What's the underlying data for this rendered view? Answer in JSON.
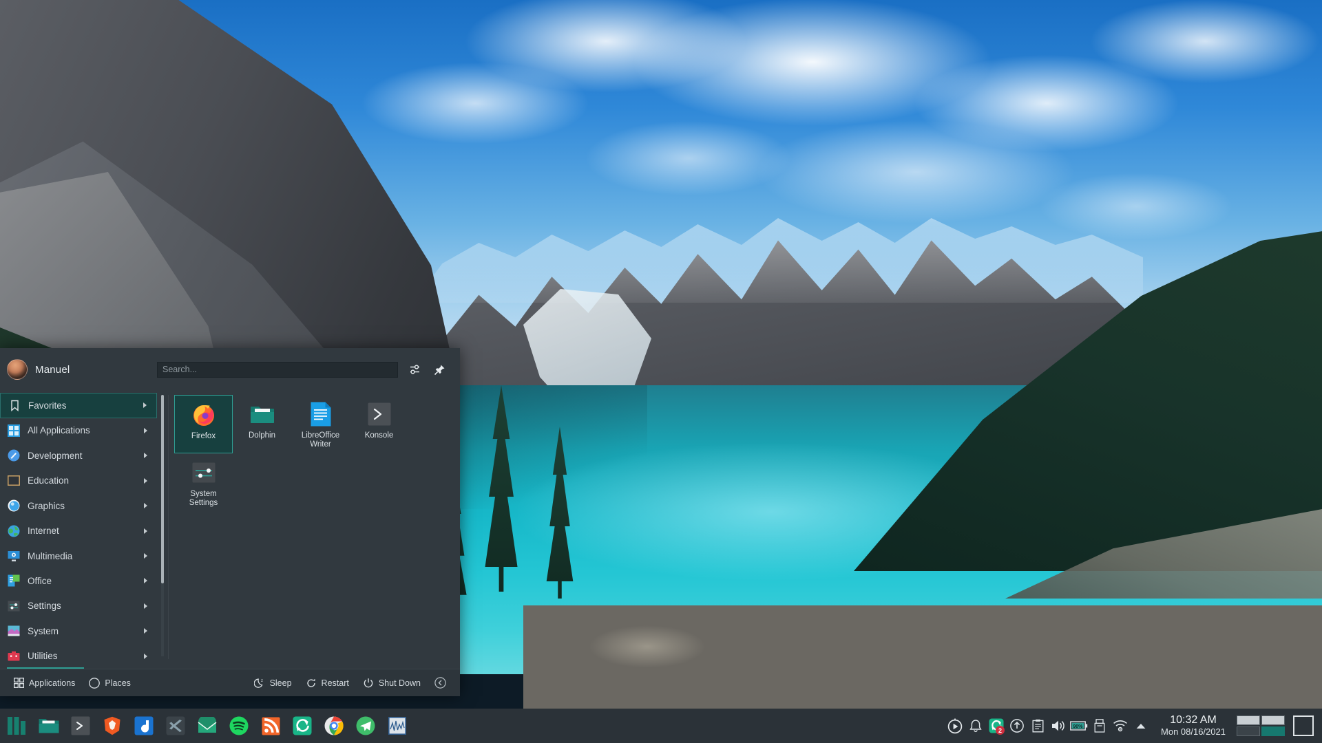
{
  "desktop": {
    "wallpaper_name": "moraine-lake-mountains",
    "theme_accent": "#2f9e93",
    "menu_bg": "#31393f",
    "panel_bg": "#2b3238"
  },
  "kickoff": {
    "user": {
      "name": "Manuel",
      "avatar_name": "user-avatar"
    },
    "search": {
      "placeholder": "Search...",
      "value": ""
    },
    "toolbar": {
      "configure_label": "configure-icon",
      "pin_label": "pin-icon"
    },
    "categories": [
      {
        "label": "Favorites",
        "icon": "bookmark-icon",
        "active": true
      },
      {
        "label": "All Applications",
        "icon": "grid-icon",
        "active": false
      },
      {
        "label": "Development",
        "icon": "development-icon",
        "active": false
      },
      {
        "label": "Education",
        "icon": "education-icon",
        "active": false
      },
      {
        "label": "Graphics",
        "icon": "graphics-icon",
        "active": false
      },
      {
        "label": "Internet",
        "icon": "internet-icon",
        "active": false
      },
      {
        "label": "Multimedia",
        "icon": "multimedia-icon",
        "active": false
      },
      {
        "label": "Office",
        "icon": "office-icon",
        "active": false
      },
      {
        "label": "Settings",
        "icon": "settings-icon",
        "active": false
      },
      {
        "label": "System",
        "icon": "system-icon",
        "active": false
      },
      {
        "label": "Utilities",
        "icon": "utilities-icon",
        "active": false
      }
    ],
    "favorites": [
      {
        "label": "Firefox",
        "icon": "firefox-icon",
        "selected": true
      },
      {
        "label": "Dolphin",
        "icon": "dolphin-icon",
        "selected": false
      },
      {
        "label": "LibreOffice Writer",
        "icon": "libreoffice-writer-icon",
        "selected": false
      },
      {
        "label": "Konsole",
        "icon": "konsole-icon",
        "selected": false
      },
      {
        "label": "System Settings",
        "icon": "system-settings-icon",
        "selected": false
      }
    ],
    "footer": {
      "applications": "Applications",
      "places": "Places",
      "sleep": "Sleep",
      "restart": "Restart",
      "shutdown": "Shut Down",
      "collapse": "collapse-icon"
    }
  },
  "panel": {
    "launcher": "manjaro-launcher-icon",
    "tasks": [
      {
        "name": "dolphin-task-icon"
      },
      {
        "name": "konsole-task-icon"
      },
      {
        "name": "brave-task-icon"
      },
      {
        "name": "joplin-task-icon"
      },
      {
        "name": "vscodium-task-icon"
      },
      {
        "name": "thunderbird-task-icon"
      },
      {
        "name": "spotify-task-icon"
      },
      {
        "name": "feedreader-task-icon"
      },
      {
        "name": "nextcloud-task-icon"
      },
      {
        "name": "chrome-task-icon"
      },
      {
        "name": "telegram-task-icon"
      },
      {
        "name": "audio-analyzer-task-icon"
      }
    ],
    "tray": [
      {
        "name": "media-player-icon",
        "badge": ""
      },
      {
        "name": "notifications-bell-icon",
        "badge": ""
      },
      {
        "name": "nextcloud-sync-icon",
        "badge": "2"
      },
      {
        "name": "software-updates-icon",
        "badge": ""
      },
      {
        "name": "clipboard-icon",
        "badge": ""
      },
      {
        "name": "volume-icon",
        "badge": ""
      },
      {
        "name": "battery-icon",
        "badge": "",
        "value": "90%"
      },
      {
        "name": "usb-device-icon",
        "badge": ""
      },
      {
        "name": "network-wifi-icon",
        "badge": ""
      },
      {
        "name": "show-hidden-tray-icon",
        "badge": ""
      }
    ],
    "clock": {
      "time": "10:32 AM",
      "date": "Mon 08/16/2021"
    },
    "pager": {
      "desktops": 4,
      "active_index": 3
    },
    "show_desktop": "show-desktop-icon"
  }
}
